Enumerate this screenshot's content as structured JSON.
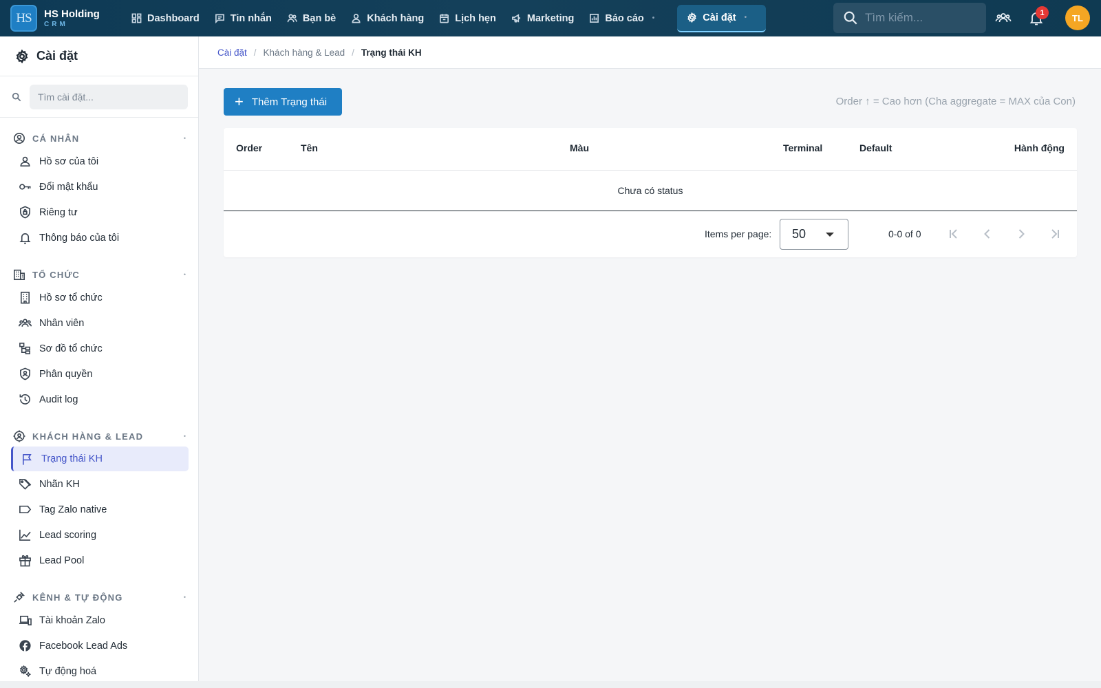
{
  "brand": {
    "logo_text": "HS",
    "name": "HS Holding",
    "sub": "CRM"
  },
  "nav": {
    "items": [
      {
        "label": "Dashboard",
        "icon": "dashboard-icon"
      },
      {
        "label": "Tin nhắn",
        "icon": "message-icon"
      },
      {
        "label": "Bạn bè",
        "icon": "friends-icon"
      },
      {
        "label": "Khách hàng",
        "icon": "customer-icon"
      },
      {
        "label": "Lịch hẹn",
        "icon": "calendar-icon"
      },
      {
        "label": "Marketing",
        "icon": "megaphone-icon"
      },
      {
        "label": "Báo cáo",
        "icon": "report-icon"
      }
    ],
    "active": {
      "label": "Cài đặt",
      "icon": "gear-icon"
    }
  },
  "top": {
    "search_placeholder": "Tìm kiếm...",
    "notification_count": "1",
    "avatar_initials": "TL"
  },
  "sidebar": {
    "title": "Cài đặt",
    "search_placeholder": "Tìm cài đặt...",
    "groups": [
      {
        "label": "CÁ NHÂN",
        "items": [
          "Hồ sơ của tôi",
          "Đổi mật khẩu",
          "Riêng tư",
          "Thông báo của tôi"
        ]
      },
      {
        "label": "TỔ CHỨC",
        "items": [
          "Hồ sơ tổ chức",
          "Nhân viên",
          "Sơ đồ tổ chức",
          "Phân quyền",
          "Audit log"
        ]
      },
      {
        "label": "KHÁCH HÀNG & LEAD",
        "items": [
          "Trạng thái KH",
          "Nhãn KH",
          "Tag Zalo native",
          "Lead scoring",
          "Lead Pool"
        ]
      },
      {
        "label": "KÊNH & TỰ ĐỘNG",
        "items": [
          "Tài khoản Zalo",
          "Facebook Lead Ads",
          "Tự động hoá"
        ]
      }
    ]
  },
  "breadcrumb": {
    "root": "Cài đặt",
    "section": "Khách hàng & Lead",
    "current": "Trạng thái KH"
  },
  "main": {
    "add_button": "Thêm Trạng thái",
    "hint": "Order ↑ = Cao hơn (Cha aggregate = MAX của Con)",
    "columns": [
      "Order",
      "Tên",
      "Màu",
      "Terminal",
      "Default",
      "Hành động"
    ],
    "empty_text": "Chưa có status",
    "paginator": {
      "items_per_page_label": "Items per page:",
      "page_size": "50",
      "range": "0-0 of 0"
    }
  }
}
